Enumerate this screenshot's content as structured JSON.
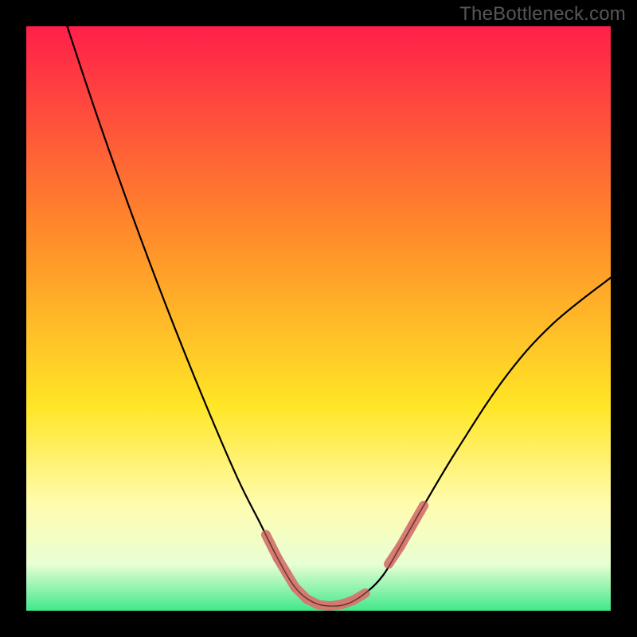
{
  "attribution": "TheBottleneck.com",
  "colors": {
    "top": "#ff1f4a",
    "mid1": "#ff8a2a",
    "mid2": "#ffe626",
    "low1": "#fffcb0",
    "low2": "#e8ffd4",
    "bottom": "#41e88d",
    "curve": "#000000",
    "marker": "#d5776f",
    "frame": "#000000"
  },
  "chart_data": {
    "type": "line",
    "title": "",
    "xlabel": "",
    "ylabel": "",
    "xlim": [
      0,
      100
    ],
    "ylim": [
      0,
      100
    ],
    "curve": [
      {
        "x": 7,
        "y": 100
      },
      {
        "x": 12,
        "y": 85
      },
      {
        "x": 18,
        "y": 68
      },
      {
        "x": 24,
        "y": 52
      },
      {
        "x": 30,
        "y": 37
      },
      {
        "x": 36,
        "y": 23
      },
      {
        "x": 40,
        "y": 15
      },
      {
        "x": 43,
        "y": 9
      },
      {
        "x": 46,
        "y": 4
      },
      {
        "x": 49,
        "y": 1.5
      },
      {
        "x": 52,
        "y": 0.8
      },
      {
        "x": 55,
        "y": 1.2
      },
      {
        "x": 58,
        "y": 3
      },
      {
        "x": 61,
        "y": 6
      },
      {
        "x": 64,
        "y": 11
      },
      {
        "x": 68,
        "y": 18
      },
      {
        "x": 74,
        "y": 28
      },
      {
        "x": 82,
        "y": 40
      },
      {
        "x": 90,
        "y": 49
      },
      {
        "x": 100,
        "y": 57
      }
    ],
    "highlight_clusters": [
      [
        {
          "x": 41,
          "y": 13
        },
        {
          "x": 43,
          "y": 9
        },
        {
          "x": 44.5,
          "y": 6.5
        },
        {
          "x": 46,
          "y": 4
        },
        {
          "x": 48,
          "y": 2
        },
        {
          "x": 50,
          "y": 1
        },
        {
          "x": 52,
          "y": 0.8
        },
        {
          "x": 54,
          "y": 1.1
        },
        {
          "x": 56,
          "y": 1.8
        },
        {
          "x": 58,
          "y": 3
        }
      ],
      [
        {
          "x": 62,
          "y": 8
        },
        {
          "x": 64,
          "y": 11
        },
        {
          "x": 66,
          "y": 14.5
        },
        {
          "x": 68,
          "y": 18
        }
      ]
    ]
  }
}
